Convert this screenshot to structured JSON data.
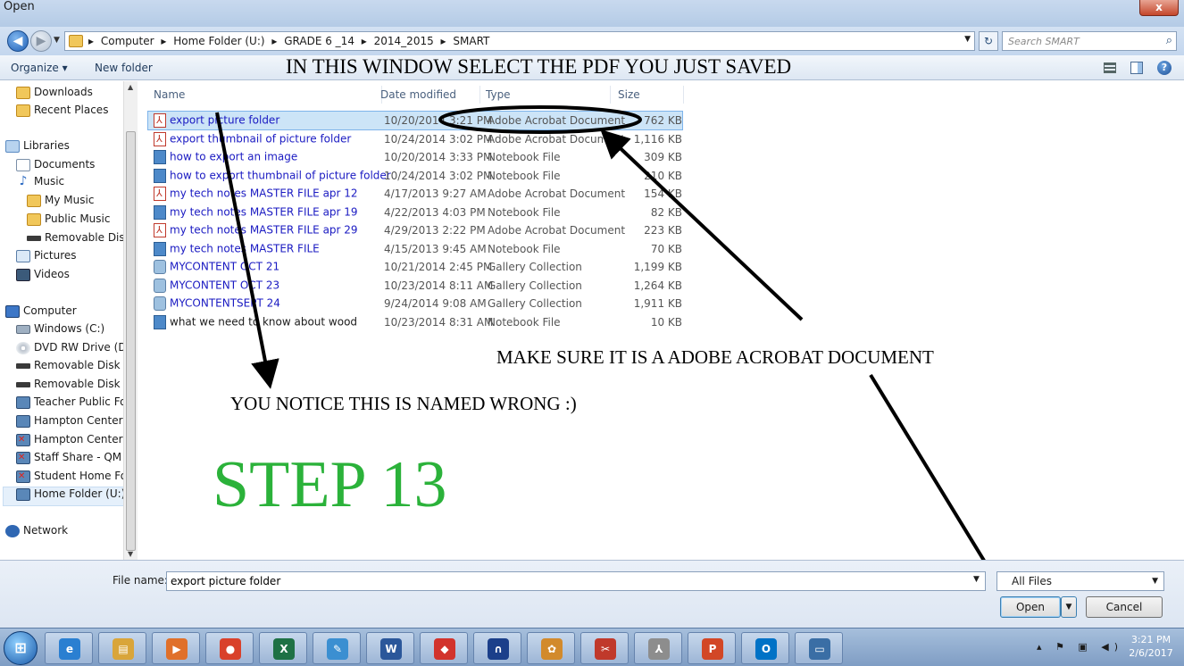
{
  "window": {
    "title": "Open",
    "close_label": "x"
  },
  "address": {
    "crumbs": [
      "Computer",
      "Home Folder (U:)",
      "GRADE 6 _14",
      "2014_2015",
      "SMART"
    ],
    "search_placeholder": "Search SMART"
  },
  "toolbar": {
    "organize_label": "Organize ▾",
    "new_folder_label": "New folder"
  },
  "annotations": {
    "instruction": "IN THIS WINDOW SELECT THE PDF YOU JUST SAVED",
    "acrobat_note": "MAKE SURE IT IS A ADOBE ACROBAT DOCUMENT",
    "named_wrong": "YOU NOTICE THIS IS NAMED WRONG :)",
    "step": "STEP 13"
  },
  "nav": {
    "items": [
      {
        "label": "Downloads",
        "icon": "folder-icon"
      },
      {
        "label": "Recent Places",
        "icon": "recent-places-icon"
      },
      {
        "label": "Libraries",
        "icon": "libraries-icon"
      },
      {
        "label": "Documents",
        "icon": "documents-icon"
      },
      {
        "label": "Music",
        "icon": "music-icon"
      },
      {
        "label": "My Music",
        "icon": "folder-icon"
      },
      {
        "label": "Public Music",
        "icon": "folder-icon"
      },
      {
        "label": "Removable Dis",
        "icon": "removable-disk-icon"
      },
      {
        "label": "Pictures",
        "icon": "pictures-icon"
      },
      {
        "label": "Videos",
        "icon": "videos-icon"
      },
      {
        "label": "Computer",
        "icon": "computer-icon"
      },
      {
        "label": "Windows (C:)",
        "icon": "drive-icon"
      },
      {
        "label": "DVD RW Drive (D",
        "icon": "dvd-drive-icon"
      },
      {
        "label": "Removable Disk (",
        "icon": "removable-disk-icon"
      },
      {
        "label": "Removable Disk (",
        "icon": "removable-disk-icon"
      },
      {
        "label": "Teacher Public Fo",
        "icon": "network-drive-icon"
      },
      {
        "label": "Hampton Center",
        "icon": "network-drive-icon"
      },
      {
        "label": "Hampton Center",
        "icon": "network-drive-disconnected-icon"
      },
      {
        "label": "Staff Share - QM",
        "icon": "network-drive-disconnected-icon"
      },
      {
        "label": "Student Home Fo",
        "icon": "network-drive-disconnected-icon"
      },
      {
        "label": "Home Folder (U:)",
        "icon": "network-drive-icon"
      },
      {
        "label": "Network",
        "icon": "network-icon"
      }
    ]
  },
  "columns": {
    "name": "Name",
    "date": "Date modified",
    "type": "Type",
    "size": "Size"
  },
  "files": [
    {
      "name": "export picture folder",
      "date": "10/20/2014 3:21 PM",
      "type": "Adobe Acrobat Document",
      "size": "762 KB",
      "kind": "pdf"
    },
    {
      "name": "export thumbnail of  picture folder",
      "date": "10/24/2014 3:02 PM",
      "type": "Adobe Acrobat Document",
      "size": "1,116 KB",
      "kind": "pdf"
    },
    {
      "name": "how to export an image",
      "date": "10/20/2014 3:33 PM",
      "type": "Notebook File",
      "size": "309 KB",
      "kind": "notebook"
    },
    {
      "name": "how to export thumbnail of picture folder",
      "date": "10/24/2014 3:02 PM",
      "type": "Notebook File",
      "size": "210 KB",
      "kind": "notebook"
    },
    {
      "name": "my tech notes MASTER FILE apr 12",
      "date": "4/17/2013 9:27 AM",
      "type": "Adobe Acrobat Document",
      "size": "154 KB",
      "kind": "pdf"
    },
    {
      "name": "my tech notes MASTER FILE apr 19",
      "date": "4/22/2013 4:03 PM",
      "type": "Notebook File",
      "size": "82 KB",
      "kind": "notebook"
    },
    {
      "name": "my tech notes MASTER FILE apr 29",
      "date": "4/29/2013 2:22 PM",
      "type": "Adobe Acrobat Document",
      "size": "223 KB",
      "kind": "pdf"
    },
    {
      "name": "my tech notes MASTER FILE",
      "date": "4/15/2013 9:45 AM",
      "type": "Notebook File",
      "size": "70 KB",
      "kind": "notebook"
    },
    {
      "name": "MYCONTENT OCT 21",
      "date": "10/21/2014 2:45 PM",
      "type": "Gallery Collection",
      "size": "1,199 KB",
      "kind": "gallery"
    },
    {
      "name": "MYCONTENT OCT 23",
      "date": "10/23/2014 8:11 AM",
      "type": "Gallery Collection",
      "size": "1,264 KB",
      "kind": "gallery"
    },
    {
      "name": "MYCONTENTSEPT 24",
      "date": "9/24/2014 9:08 AM",
      "type": "Gallery Collection",
      "size": "1,911 KB",
      "kind": "gallery"
    },
    {
      "name": "what we need to know about wood",
      "date": "10/23/2014 8:31 AM",
      "type": "Notebook File",
      "size": "10 KB",
      "kind": "notebook",
      "plain": true
    }
  ],
  "bottom": {
    "file_name_label": "File name:",
    "file_name_value": "export picture folder",
    "filter_value": "All Files",
    "open_label": "Open",
    "cancel_label": "Cancel"
  },
  "taskbar": {
    "apps": [
      {
        "name": "internet-explorer",
        "glyph": "e",
        "color": "#2a7fd1"
      },
      {
        "name": "file-explorer",
        "glyph": "▤",
        "color": "#d9a53a"
      },
      {
        "name": "media-player",
        "glyph": "▶",
        "color": "#e0702a"
      },
      {
        "name": "chrome",
        "glyph": "●",
        "color": "#d9412b"
      },
      {
        "name": "excel",
        "glyph": "X",
        "color": "#1e7145"
      },
      {
        "name": "smart-notebook",
        "glyph": "✎",
        "color": "#3b8fd1"
      },
      {
        "name": "word",
        "glyph": "W",
        "color": "#2b579a"
      },
      {
        "name": "app-red",
        "glyph": "◆",
        "color": "#d2332c"
      },
      {
        "name": "audacity",
        "glyph": "∩",
        "color": "#1b3f8a"
      },
      {
        "name": "paint-app",
        "glyph": "✿",
        "color": "#d28a2c"
      },
      {
        "name": "snipping-tool",
        "glyph": "✂",
        "color": "#c0392b"
      },
      {
        "name": "acrobat",
        "glyph": "⅄",
        "color": "#8d8d8d"
      },
      {
        "name": "powerpoint",
        "glyph": "P",
        "color": "#d24726"
      },
      {
        "name": "outlook",
        "glyph": "O",
        "color": "#0072c6"
      },
      {
        "name": "screen-capture",
        "glyph": "▭",
        "color": "#3a6ea5"
      }
    ],
    "time": "3:21 PM",
    "date": "2/6/2017"
  }
}
